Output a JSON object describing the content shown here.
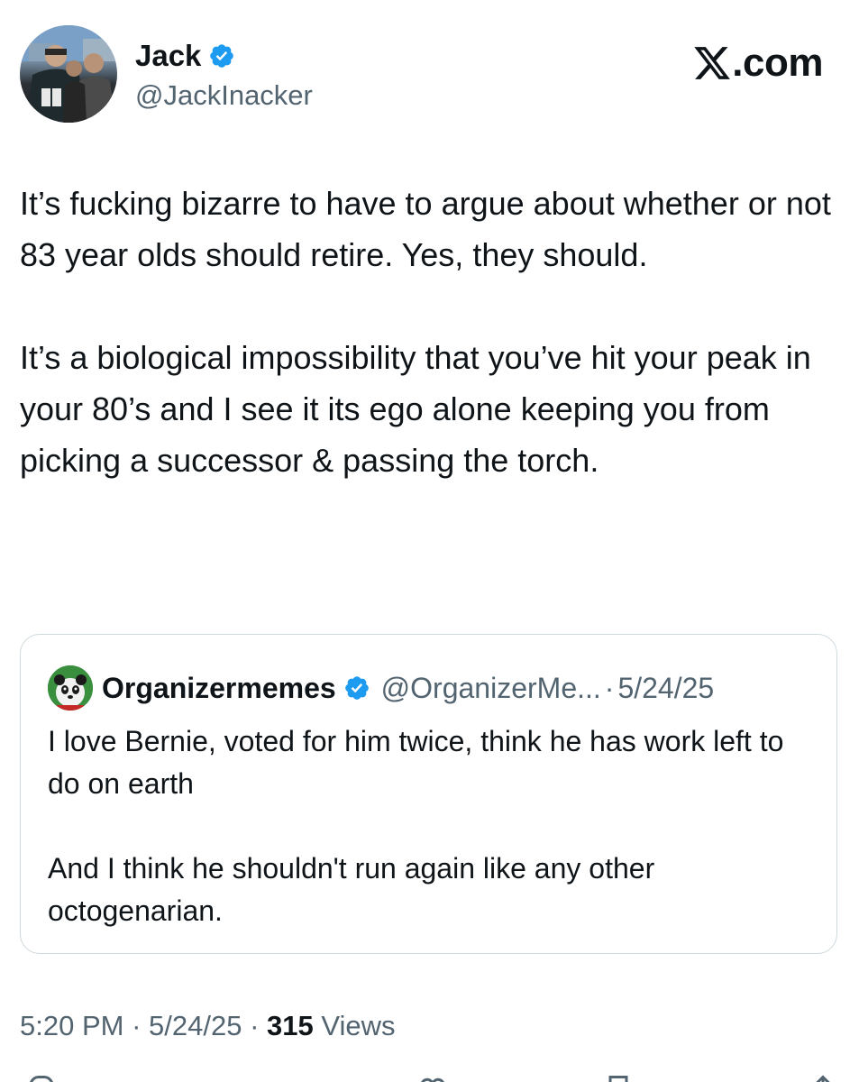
{
  "author": {
    "display_name": "Jack",
    "handle": "@JackInacker",
    "verified": true
  },
  "brand": {
    "logo_icon": "x-logo-icon",
    "text": ".com"
  },
  "tweet": {
    "paragraphs": [
      "It’s fucking bizarre to have to argue about whether or not 83 year olds should retire. Yes, they should.",
      "It’s a biological impossibility that you’ve hit your peak in your 80’s and I see it its ego alone keeping you from picking a successor & passing the torch."
    ]
  },
  "quoted_tweet": {
    "display_name": "Organizermemes",
    "handle": "@OrganizerMe...",
    "separator": "·",
    "date": "5/24/25",
    "verified": true,
    "paragraphs": [
      "I love Bernie, voted for him twice, think he has work left to do on earth",
      "And I think he shouldn't run again like any other octogenarian."
    ]
  },
  "meta": {
    "time": "5:20 PM",
    "separator": "·",
    "date": "5/24/25",
    "views_count": "315",
    "views_label": "Views"
  },
  "colors": {
    "text": "#0f1419",
    "secondary": "#536471",
    "verified_blue": "#1d9bf0",
    "border": "#cfd9de"
  }
}
